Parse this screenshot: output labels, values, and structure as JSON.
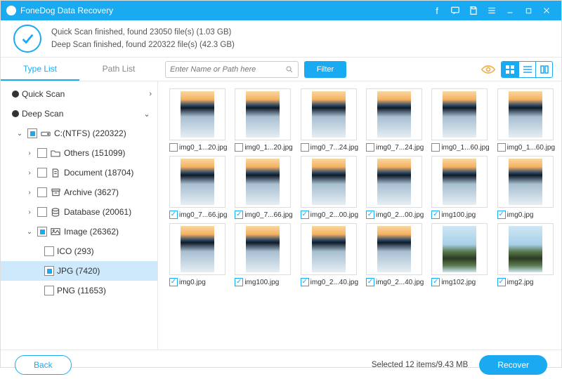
{
  "app_title": "FoneDog Data Recovery",
  "status_line1": "Quick Scan finished, found 23050 file(s) (1.03 GB)",
  "status_line2": "Deep Scan finished, found 220322 file(s) (42.3 GB)",
  "tabs": {
    "type": "Type List",
    "path": "Path List"
  },
  "search": {
    "placeholder": "Enter Name or Path here"
  },
  "filter_label": "Filter",
  "tree": {
    "quick_scan": "Quick Scan",
    "deep_scan": "Deep Scan",
    "drive": "C:(NTFS) (220322)",
    "others": "Others (151099)",
    "document": "Document (18704)",
    "archive": "Archive (3627)",
    "database": "Database (20061)",
    "image": "Image (26362)",
    "ico": "ICO (293)",
    "jpg": "JPG (7420)",
    "png": "PNG (11653)"
  },
  "grid": {
    "r0": [
      "img0_1...20.jpg",
      "img0_1...20.jpg",
      "img0_7...24.jpg",
      "img0_7...24.jpg",
      "img0_1...60.jpg",
      "img0_1...60.jpg"
    ],
    "r1": [
      "img0_7...66.jpg",
      "img0_7...66.jpg",
      "img0_2...00.jpg",
      "img0_2...00.jpg",
      "img100.jpg",
      "img0.jpg"
    ],
    "r2": [
      "img0.jpg",
      "img100.jpg",
      "img0_2...40.jpg",
      "img0_2...40.jpg",
      "img102.jpg",
      "img2.jpg"
    ]
  },
  "footer": {
    "back": "Back",
    "status": "Selected 12 items/9.43 MB",
    "recover": "Recover"
  }
}
